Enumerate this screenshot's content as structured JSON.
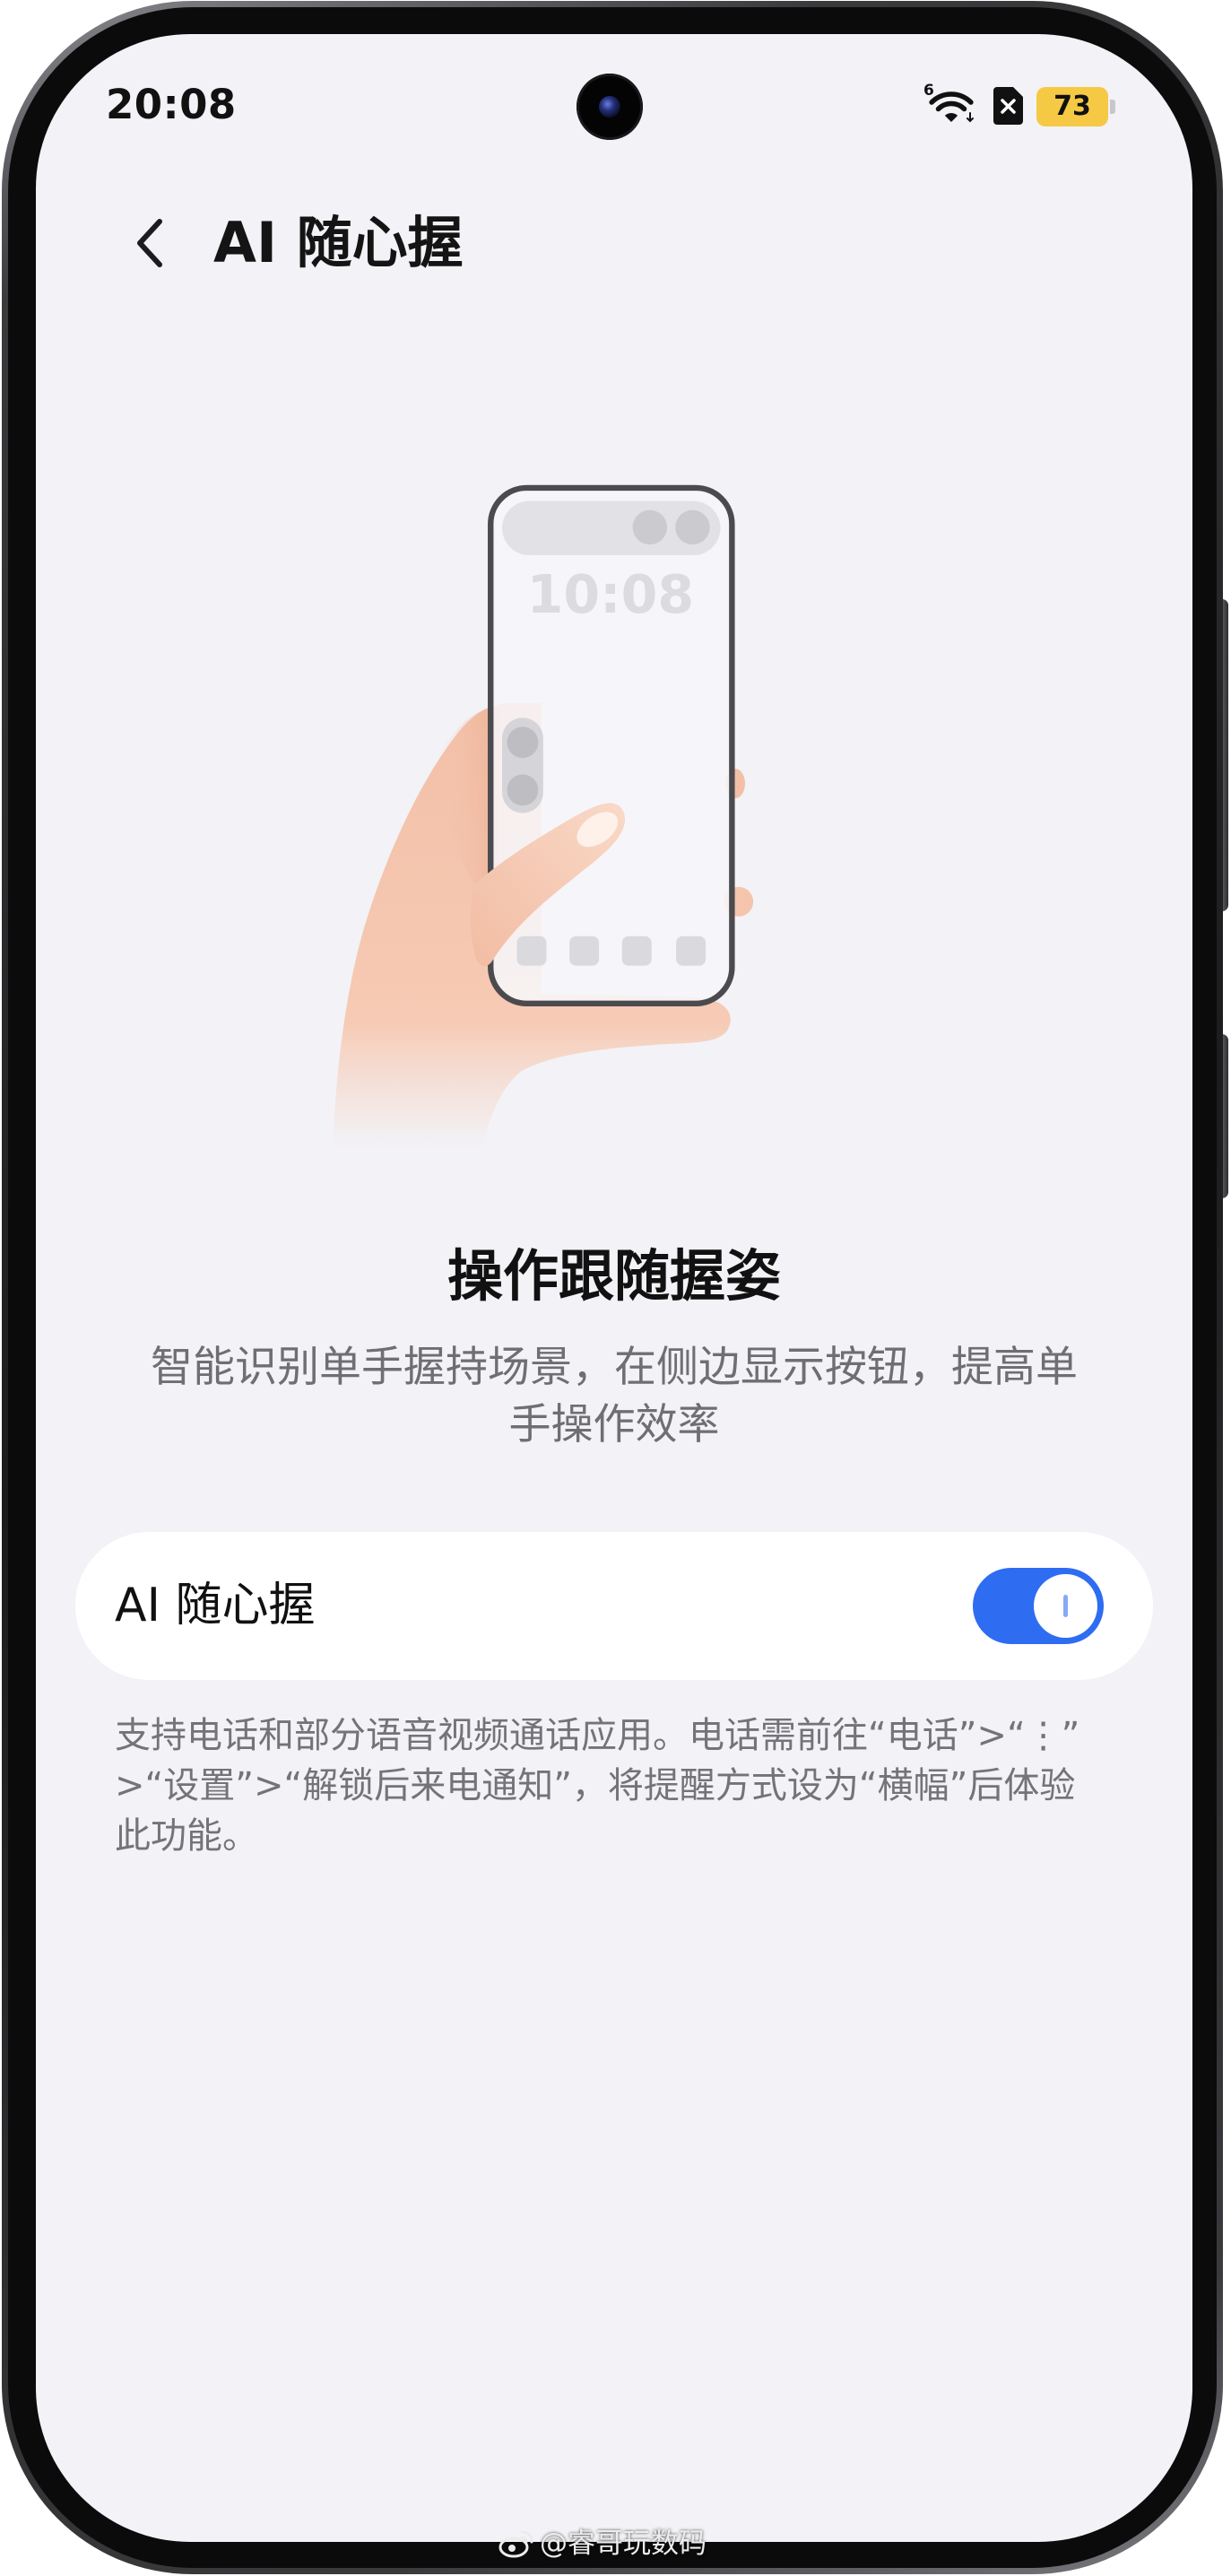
{
  "status_bar": {
    "time": "20:08",
    "wifi_generation": "6",
    "battery_level": "73",
    "icons": [
      "wifi-icon",
      "sim-missing-icon",
      "battery-icon"
    ]
  },
  "header": {
    "back_icon": "chevron-left-icon",
    "title": "AI 随心握"
  },
  "illustration": {
    "clock": "10:08"
  },
  "feature": {
    "heading": "操作跟随握姿",
    "description_lines": [
      "智能识别单手握持场景，在侧边显示按钮，提高单",
      "手操作效率"
    ]
  },
  "setting_card": {
    "label": "AI 随心握",
    "toggle_on": true
  },
  "footnote": {
    "lines": [
      "支持电话和部分语音视频通话应用。电话需前往“电话”>“⋮”",
      ">“设置”>“解锁后来电通知”，将提醒方式设为“横幅”后体验",
      "此功能。"
    ]
  },
  "watermark": {
    "icon": "weibo-icon",
    "text": "@睿哥玩数码"
  },
  "colors": {
    "accent": "#2E6CF2",
    "screen_background": "#F2F2F7",
    "card_background": "#FFFFFF",
    "battery": "#F6C945"
  }
}
